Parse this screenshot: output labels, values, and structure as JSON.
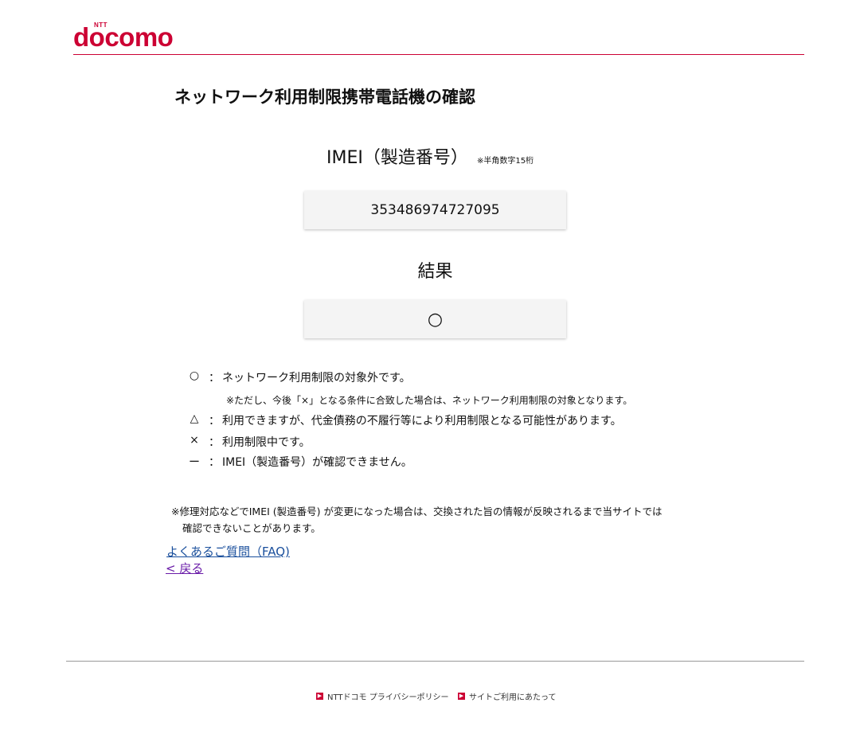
{
  "brand": {
    "ntt": "NTT",
    "name": "docomo"
  },
  "page": {
    "title": "ネットワーク利用制限携帯電話機の確認"
  },
  "imei": {
    "label": "IMEI（製造番号）",
    "note": "※半角数字15桁",
    "value": "353486974727095"
  },
  "result": {
    "label": "結果",
    "value": "○"
  },
  "legend": [
    {
      "symbol": "○",
      "text": "ネットワーク利用制限の対象外です。",
      "sub": "※ただし、今後「×」となる条件に合致した場合は、ネットワーク利用制限の対象となります。"
    },
    {
      "symbol": "△",
      "text": "利用できますが、代金債務の不履行等により利用制限となる可能性があります。"
    },
    {
      "symbol": "×",
      "text": "利用制限中です。"
    },
    {
      "symbol": "ー",
      "text": "IMEI（製造番号）が確認できません。"
    }
  ],
  "legend_colon": "：",
  "notice": {
    "line1": "※修理対応などでIMEI (製造番号) が変更になった場合は、交換された旨の情報が反映されるまで当サイトでは",
    "line2": "確認できないことがあります。"
  },
  "links": {
    "faq": "よくあるご質問（FAQ)",
    "back": "< 戻る"
  },
  "footer": {
    "privacy": "NTTドコモ プライバシーポリシー",
    "terms": "サイトご利用にあたって",
    "arrow": "▶"
  },
  "colors": {
    "brand": "#cc0033",
    "link": "#1a4f9c",
    "visited": "#6a1ca8"
  }
}
